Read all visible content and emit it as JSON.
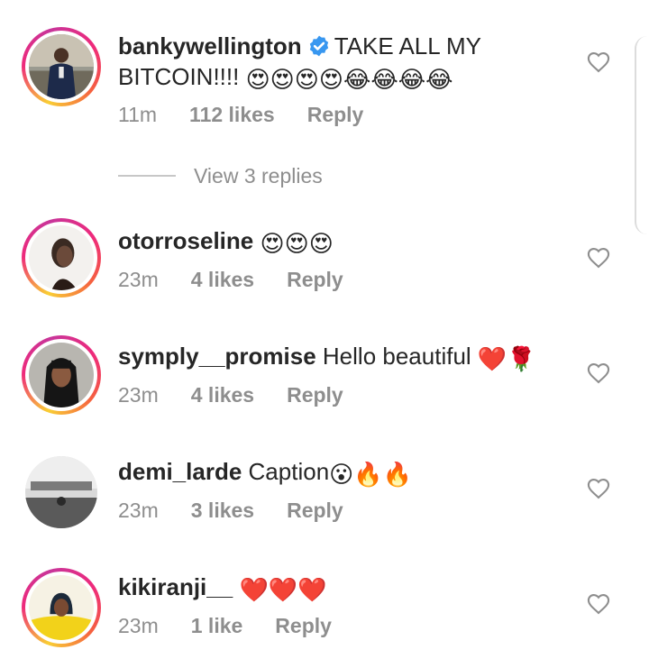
{
  "comments": [
    {
      "username": "bankywellington",
      "verified": true,
      "text_line1": "TAKE ALL MY",
      "text_line2": "BITCOIN!!!!",
      "emojis": "😍😍😍😍😂😂😂😂",
      "time": "11m",
      "likes": "112 likes",
      "reply": "Reply",
      "view_replies": "View 3 replies"
    },
    {
      "username": "otorroseline",
      "text": "",
      "emojis": "😍😍😍",
      "time": "23m",
      "likes": "4 likes",
      "reply": "Reply"
    },
    {
      "username": "symply__promise",
      "text": "Hello beautiful",
      "emojis": "❤️🌹",
      "time": "23m",
      "likes": "4 likes",
      "reply": "Reply"
    },
    {
      "username": "demi_larde",
      "text": "Caption",
      "emojis": "😮🔥🔥",
      "time": "23m",
      "likes": "3 likes",
      "reply": "Reply"
    },
    {
      "username": "kikiranji__",
      "text": "",
      "emojis": "❤️❤️❤️",
      "time": "23m",
      "likes": "1 like",
      "reply": "Reply"
    }
  ],
  "colors": {
    "username": "#262626",
    "meta": "#8e8e8e",
    "verified": "#3897f0",
    "heart_outline": "#8e8e8e"
  },
  "icons": {
    "like": "heart-outline-icon",
    "verified": "verified-badge-icon"
  }
}
